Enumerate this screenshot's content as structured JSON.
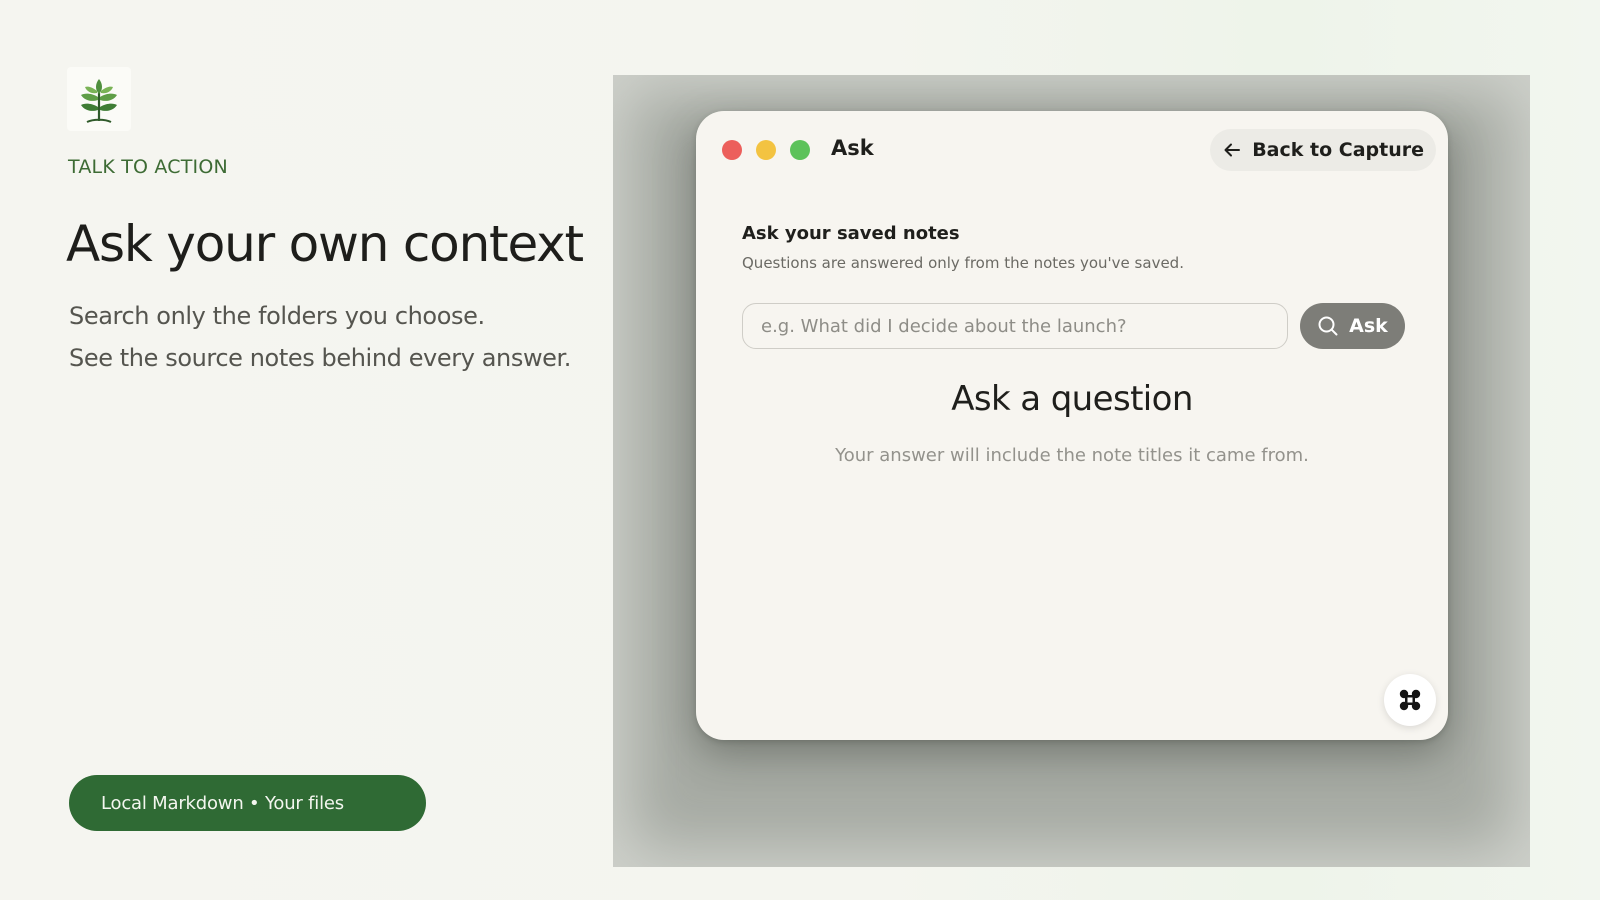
{
  "hero": {
    "logo_icon": "sprout-icon",
    "eyebrow": "TALK TO ACTION",
    "headline": "Ask your own context",
    "sub_line_1": "Search only the folders you choose.",
    "sub_line_2": "See the source notes behind every answer.",
    "badge": "Local Markdown • Your files"
  },
  "window": {
    "title": "Ask",
    "back_button_label": "Back to Capture",
    "back_icon": "arrow-left-icon",
    "section_title": "Ask your saved notes",
    "section_description": "Questions are answered only from the notes you've saved.",
    "input": {
      "value": "",
      "placeholder": "e.g. What did I decide about the launch?"
    },
    "ask_button_label": "Ask",
    "ask_icon": "search-icon",
    "empty_state": {
      "title": "Ask a question",
      "description": "Your answer will include the note titles it came from."
    },
    "fab_icon": "command-icon"
  },
  "colors": {
    "accent_green": "#2f6a34",
    "eyebrow_green": "#3d6b34",
    "traffic_red": "#ec5f5b",
    "traffic_yellow": "#f3c341",
    "traffic_green": "#5cc25a",
    "ask_button": "#7d7d78"
  }
}
